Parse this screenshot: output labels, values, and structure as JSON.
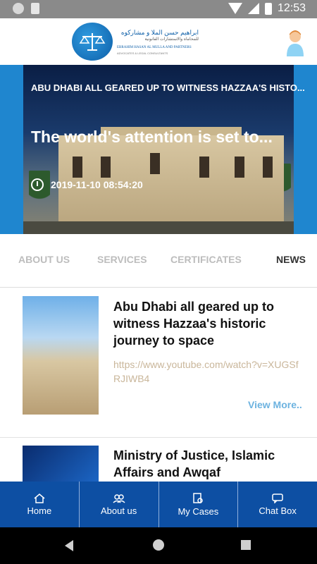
{
  "status_bar": {
    "time": "12:53"
  },
  "header": {
    "logo_arabic": "ابراهيم حسن الملا و مشاركوه",
    "logo_arabic_sub": "للمحاماة والاستشارات القانونية",
    "logo_english": "EBRAHIM HASAN AL MULLA AND PARTNERS",
    "logo_english_sub": "ADVOCATES & LEGAL CONSULTANTS"
  },
  "hero": {
    "title_small": "ABU DHABI ALL GEARED UP TO WITNESS HAZZAA'S HISTO...",
    "title": "The world's attention is set to...",
    "timestamp": "2019-11-10 08:54:20"
  },
  "tabs": [
    {
      "label": "ABOUT US"
    },
    {
      "label": "SERVICES"
    },
    {
      "label": "CERTIFICATES"
    },
    {
      "label": "NEWS",
      "active": true
    }
  ],
  "news": [
    {
      "title": "Abu Dhabi all geared up to witness Hazzaa's historic journey to space",
      "link": "https://www.youtube.com/watch?v=XUGSfRJIWB4",
      "view_more": "View More.."
    },
    {
      "title": "Ministry of Justice, Islamic Affairs and Awqaf"
    }
  ],
  "bottom_nav": [
    {
      "label": "Home",
      "icon": "home-icon"
    },
    {
      "label": "About us",
      "icon": "users-icon"
    },
    {
      "label": "My Cases",
      "icon": "cases-icon"
    },
    {
      "label": "Chat Box",
      "icon": "chat-icon"
    }
  ]
}
